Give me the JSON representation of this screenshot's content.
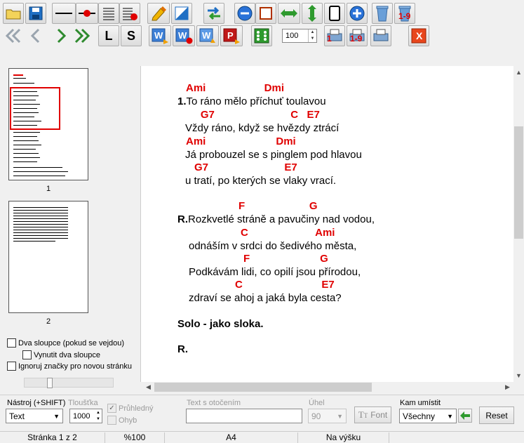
{
  "toolbar": {
    "zoom_value": "100",
    "letter_l": "L",
    "letter_s": "S",
    "delete_numbers_label": "1-9",
    "print_one_label": "1",
    "print_range_label": "1-9",
    "pdf_label": "P",
    "close_label": "X"
  },
  "sidebar": {
    "pages": [
      {
        "label": "1"
      },
      {
        "label": "2"
      }
    ],
    "options": [
      {
        "label": "Dva sloupce (pokud se vejdou)",
        "checked": false
      },
      {
        "label": "Vynutit dva sloupce",
        "checked": false
      },
      {
        "label": "Ignoruj značky pro novou stránku",
        "checked": false
      }
    ]
  },
  "song": {
    "lines": [
      {
        "type": "chords",
        "text": "Ami                    Dmi"
      },
      {
        "type": "lyric",
        "prefix": "1.",
        "text": "To ráno mělo příchuť toulavou"
      },
      {
        "type": "chords",
        "text": "     G7                          C   E7"
      },
      {
        "type": "lyric",
        "prefix": "",
        "text": "Vždy ráno, když se hvězdy ztrácí"
      },
      {
        "type": "chords",
        "text": "Ami                        Dmi"
      },
      {
        "type": "lyric",
        "prefix": "",
        "text": "Já probouzel se s pinglem pod hlavou"
      },
      {
        "type": "chords",
        "text": "G7                          E7"
      },
      {
        "type": "lyric",
        "prefix": "",
        "text": "u tratí, po kterých se vlaky vrací."
      },
      {
        "type": "chords",
        "text": "F                      G"
      },
      {
        "type": "lyric",
        "prefix": "R.",
        "text": "Rozkvetlé stráně a pavučiny nad vodou,"
      },
      {
        "type": "chords",
        "text": "C                       Ami"
      },
      {
        "type": "lyric",
        "prefix": "",
        "text": "odnáším v srdci do šedivého města,"
      },
      {
        "type": "chords",
        "text": "F                        G"
      },
      {
        "type": "lyric",
        "prefix": "",
        "text": "Podkávám lidi, co opilí jsou přírodou,"
      },
      {
        "type": "chords",
        "text": "C                           E7"
      },
      {
        "type": "lyric",
        "prefix": "",
        "text": "zdraví se ahoj a jaká byla cesta?"
      },
      {
        "type": "heading",
        "text": "Solo - jako sloka."
      },
      {
        "type": "heading",
        "text": "R."
      }
    ]
  },
  "bottom": {
    "tool_label": "Nástroj (+SHIFT)",
    "tool_value": "Text",
    "thickness_label": "Tloušťka",
    "thickness_value": "1000",
    "transparent_label": "Průhledný",
    "bend_label": "Ohyb",
    "rotated_text_label": "Text s otočením",
    "rotated_text_value": "",
    "angle_label": "Úhel",
    "angle_value": "90",
    "font_label": "Font",
    "place_label": "Kam umístit",
    "place_value": "Všechny",
    "reset_label": "Reset"
  },
  "status": {
    "page": "Stránka 1 z 2",
    "zoom": "%100",
    "paper": "A4",
    "orientation": "Na výšku"
  }
}
